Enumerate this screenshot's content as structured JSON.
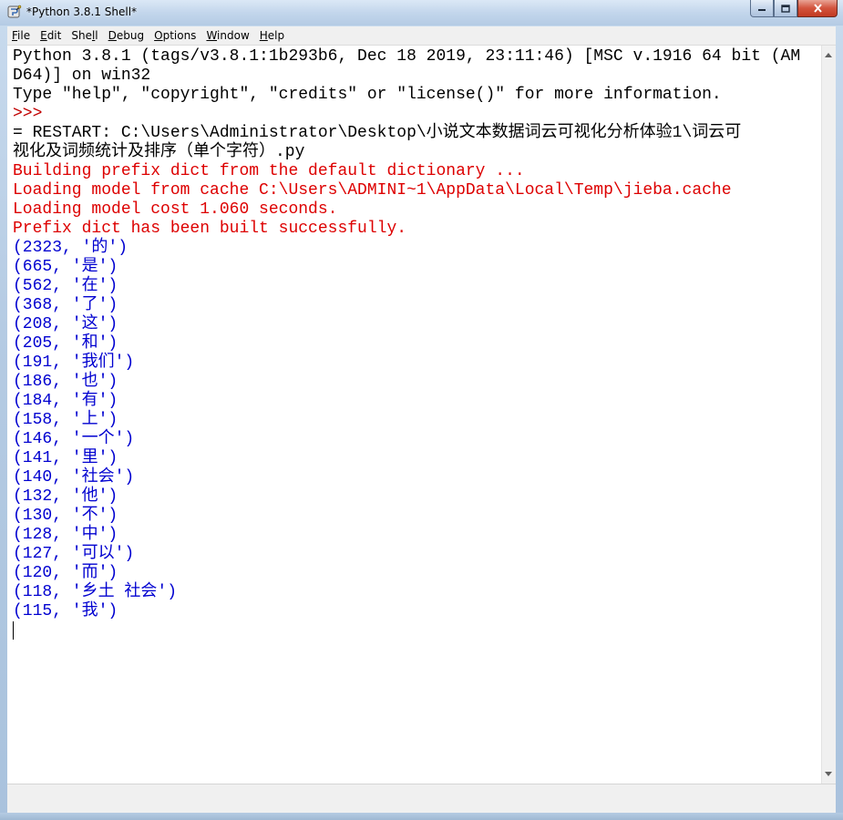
{
  "window": {
    "title": "*Python 3.8.1 Shell*"
  },
  "menu": {
    "items": [
      {
        "label": "File",
        "key": "F",
        "rest": "ile"
      },
      {
        "label": "Edit",
        "key": "E",
        "rest": "dit"
      },
      {
        "label": "Shell",
        "pre": "She",
        "key": "l",
        "rest": "l"
      },
      {
        "label": "Debug",
        "key": "D",
        "rest": "ebug"
      },
      {
        "label": "Options",
        "key": "O",
        "rest": "ptions"
      },
      {
        "label": "Window",
        "key": "W",
        "rest": "indow"
      },
      {
        "label": "Help",
        "key": "H",
        "rest": "elp"
      }
    ]
  },
  "shell": {
    "lines": [
      {
        "text": "Python 3.8.1 (tags/v3.8.1:1b293b6, Dec 18 2019, 23:11:46) [MSC v.1916 64 bit (AM",
        "kind": "out"
      },
      {
        "text": "D64)] on win32",
        "kind": "out"
      },
      {
        "text": "Type \"help\", \"copyright\", \"credits\" or \"license()\" for more information.",
        "kind": "out"
      },
      {
        "text": ">>> ",
        "kind": "prompt"
      },
      {
        "text": "= RESTART: C:\\Users\\Administrator\\Desktop\\小说文本数据词云可视化分析体验1\\词云可",
        "kind": "out"
      },
      {
        "text": "视化及词频统计及排序（单个字符）.py",
        "kind": "out"
      },
      {
        "text": "Building prefix dict from the default dictionary ...",
        "kind": "err"
      },
      {
        "text": "Loading model from cache C:\\Users\\ADMINI~1\\AppData\\Local\\Temp\\jieba.cache",
        "kind": "err"
      },
      {
        "text": "Loading model cost 1.060 seconds.",
        "kind": "err"
      },
      {
        "text": "Prefix dict has been built successfully.",
        "kind": "err"
      },
      {
        "text": "(2323, '的')",
        "kind": "res"
      },
      {
        "text": "(665, '是')",
        "kind": "res"
      },
      {
        "text": "(562, '在')",
        "kind": "res"
      },
      {
        "text": "(368, '了')",
        "kind": "res"
      },
      {
        "text": "(208, '这')",
        "kind": "res"
      },
      {
        "text": "(205, '和')",
        "kind": "res"
      },
      {
        "text": "(191, '我们')",
        "kind": "res"
      },
      {
        "text": "(186, '也')",
        "kind": "res"
      },
      {
        "text": "(184, '有')",
        "kind": "res"
      },
      {
        "text": "(158, '上')",
        "kind": "res"
      },
      {
        "text": "(146, '一个')",
        "kind": "res"
      },
      {
        "text": "(141, '里')",
        "kind": "res"
      },
      {
        "text": "(140, '社会')",
        "kind": "res"
      },
      {
        "text": "(132, '他')",
        "kind": "res"
      },
      {
        "text": "(130, '不')",
        "kind": "res"
      },
      {
        "text": "(128, '中')",
        "kind": "res"
      },
      {
        "text": "(127, '可以')",
        "kind": "res"
      },
      {
        "text": "(120, '而')",
        "kind": "res"
      },
      {
        "text": "(118, '乡土 社会')",
        "kind": "res"
      },
      {
        "text": "(115, '我')",
        "kind": "res"
      }
    ]
  },
  "colors": {
    "output": "#000000",
    "prompt": "#c00000",
    "stderr": "#dd0000",
    "result": "#0000d0"
  },
  "icons": {
    "app": "python-idle-icon",
    "minimize": "minimize-icon",
    "maximize": "maximize-icon",
    "close": "close-icon"
  }
}
